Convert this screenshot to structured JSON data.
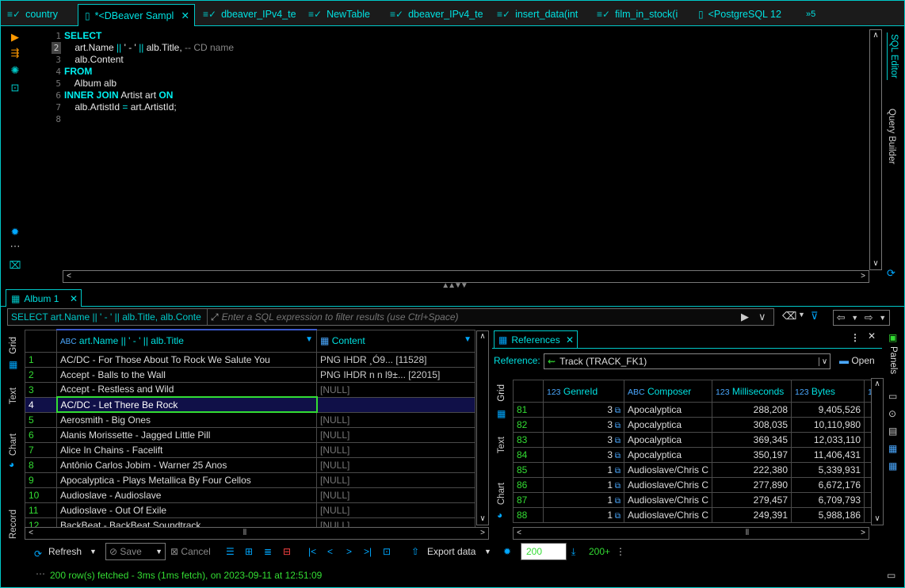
{
  "tabs": [
    {
      "label": "country",
      "icon": "sql-script-icon"
    },
    {
      "label": "*<DBeaver Sampl",
      "icon": "sql-console-icon",
      "active": true
    },
    {
      "label": "dbeaver_IPv4_te",
      "icon": "sql-script-icon"
    },
    {
      "label": "NewTable",
      "icon": "sql-script-icon"
    },
    {
      "label": "dbeaver_IPv4_te",
      "icon": "sql-script-icon"
    },
    {
      "label": "insert_data(int",
      "icon": "sql-script-icon"
    },
    {
      "label": "film_in_stock(i",
      "icon": "sql-script-icon"
    },
    {
      "label": "<PostgreSQL 12",
      "icon": "sql-console-icon"
    },
    {
      "label": "»5",
      "icon": "more-tabs-icon"
    }
  ],
  "editor": {
    "line_numbers": [
      "1",
      "2",
      "3",
      "4",
      "5",
      "6",
      "7",
      "8"
    ],
    "lines": [
      {
        "parts": [
          {
            "t": "SELECT",
            "c": "kw"
          }
        ]
      },
      {
        "parts": [
          {
            "t": "    art.Name ",
            "c": ""
          },
          {
            "t": "||",
            "c": "op"
          },
          {
            "t": " ' - ' ",
            "c": ""
          },
          {
            "t": "||",
            "c": "op"
          },
          {
            "t": " alb.Title, ",
            "c": ""
          },
          {
            "t": "-- CD name",
            "c": "cm"
          }
        ]
      },
      {
        "parts": [
          {
            "t": "    alb.Content",
            "c": ""
          }
        ]
      },
      {
        "parts": [
          {
            "t": "FROM",
            "c": "kw"
          }
        ]
      },
      {
        "parts": [
          {
            "t": "    Album alb",
            "c": ""
          }
        ]
      },
      {
        "parts": [
          {
            "t": "INNER JOIN",
            "c": "kw"
          },
          {
            "t": " Artist art ",
            "c": ""
          },
          {
            "t": "ON",
            "c": "kw"
          }
        ]
      },
      {
        "parts": [
          {
            "t": "    alb.ArtistId ",
            "c": ""
          },
          {
            "t": "=",
            "c": "op"
          },
          {
            "t": " art.ArtistId;",
            "c": ""
          }
        ]
      },
      {
        "parts": [
          {
            "t": "",
            "c": ""
          }
        ]
      }
    ],
    "right_tabs": [
      "SQL Editor",
      "Query Builder"
    ]
  },
  "results": {
    "tab_label": "Album 1",
    "filter_query": "SELECT art.Name || ' - ' || alb.Title, alb.Conte",
    "filter_placeholder": "Enter a SQL expression to filter results (use Ctrl+Space)",
    "side_tabs": [
      "Grid",
      "Text",
      "Chart",
      "Record"
    ],
    "columns": [
      "art.Name || ' - ' || alb.Title",
      "Content"
    ],
    "rows": [
      {
        "n": "1",
        "name": "AC/DC  - For Those About To Rock We Salute You",
        "content": "PNG      IHDR         ¸Ó9...  [11528]"
      },
      {
        "n": "2",
        "name": "Accept  - Balls to the Wall",
        "content": "PNG      IHDR   n   n    l9±...  [22015]"
      },
      {
        "n": "3",
        "name": "Accept  - Restless and Wild",
        "content": "[NULL]"
      },
      {
        "n": "4",
        "name": "AC/DC  - Let There Be Rock",
        "content": "",
        "selected": true
      },
      {
        "n": "5",
        "name": "Aerosmith  - Big Ones",
        "content": "[NULL]"
      },
      {
        "n": "6",
        "name": "Alanis Morissette  - Jagged Little Pill",
        "content": "[NULL]"
      },
      {
        "n": "7",
        "name": "Alice In Chains  - Facelift",
        "content": "[NULL]"
      },
      {
        "n": "8",
        "name": "Antônio Carlos Jobim  - Warner 25 Anos",
        "content": "[NULL]"
      },
      {
        "n": "9",
        "name": "Apocalyptica  - Plays Metallica By Four Cellos",
        "content": "[NULL]"
      },
      {
        "n": "10",
        "name": "Audioslave  - Audioslave",
        "content": "[NULL]"
      },
      {
        "n": "11",
        "name": "Audioslave  - Out Of Exile",
        "content": "[NULL]"
      },
      {
        "n": "12",
        "name": "BackBeat  - BackBeat Soundtrack",
        "content": "[NULL]"
      }
    ]
  },
  "references": {
    "tab_label": "References",
    "label": "Reference:",
    "selected": "Track (TRACK_FK1)",
    "open_label": "Open",
    "side_tabs": [
      "Grid",
      "Text",
      "Chart"
    ],
    "columns": [
      {
        "type": "123",
        "name": "GenreId"
      },
      {
        "type": "ABC",
        "name": "Composer"
      },
      {
        "type": "123",
        "name": "Milliseconds"
      },
      {
        "type": "123",
        "name": "Bytes"
      },
      {
        "type": "12",
        "name": ""
      }
    ],
    "rows": [
      {
        "n": "81",
        "genre": "3",
        "composer": "Apocalyptica",
        "ms": "288,208",
        "bytes": "9,405,526"
      },
      {
        "n": "82",
        "genre": "3",
        "composer": "Apocalyptica",
        "ms": "308,035",
        "bytes": "10,110,980"
      },
      {
        "n": "83",
        "genre": "3",
        "composer": "Apocalyptica",
        "ms": "369,345",
        "bytes": "12,033,110"
      },
      {
        "n": "84",
        "genre": "3",
        "composer": "Apocalyptica",
        "ms": "350,197",
        "bytes": "11,406,431"
      },
      {
        "n": "85",
        "genre": "1",
        "composer": "Audioslave/Chris C",
        "ms": "222,380",
        "bytes": "5,339,931"
      },
      {
        "n": "86",
        "genre": "1",
        "composer": "Audioslave/Chris C",
        "ms": "277,890",
        "bytes": "6,672,176"
      },
      {
        "n": "87",
        "genre": "1",
        "composer": "Audioslave/Chris C",
        "ms": "279,457",
        "bytes": "6,709,793"
      },
      {
        "n": "88",
        "genre": "1",
        "composer": "Audioslave/Chris C",
        "ms": "249,391",
        "bytes": "5,988,186"
      }
    ],
    "panels_label": "Panels"
  },
  "toolbar": {
    "refresh": "Refresh",
    "save": "Save",
    "cancel": "Cancel",
    "export": "Export data",
    "fetch_size": "200",
    "fetch_more": "200+"
  },
  "status": "200 row(s) fetched - 3ms (1ms fetch), on 2023-09-11 at 12:51:09"
}
